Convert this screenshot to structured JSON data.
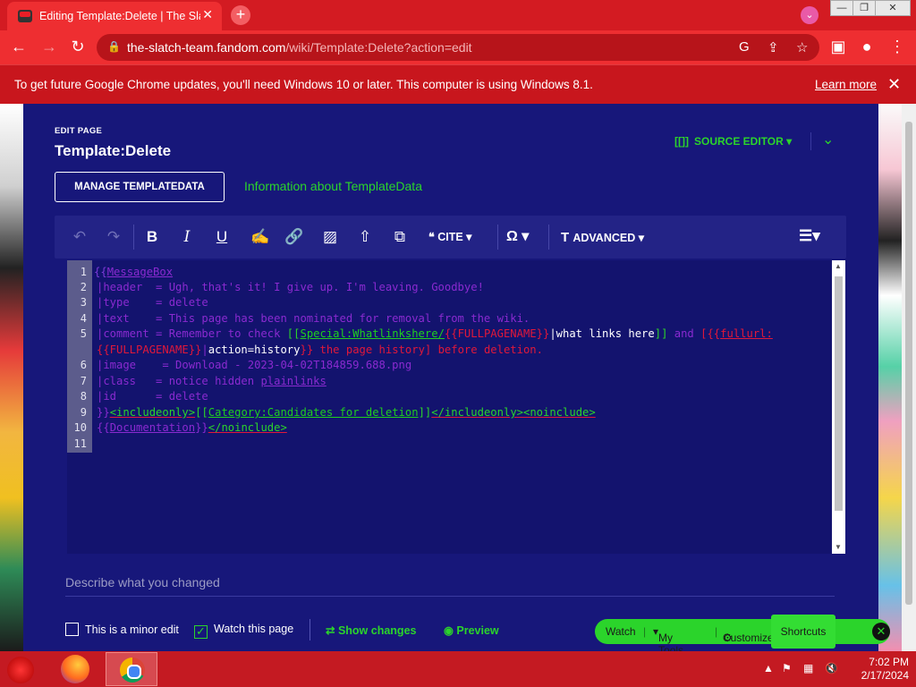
{
  "browser": {
    "tab_title": "Editing Template:Delete | The Sla",
    "tab_close": "✕",
    "new_tab": "+",
    "url_host": "the-slatch-team.fandom.com",
    "url_path": "/wiki/Template:Delete?action=edit",
    "window_min": "—",
    "window_max": "❐",
    "window_close": "✕"
  },
  "infobar": {
    "message": "To get future Google Chrome updates, you'll need Windows 10 or later. This computer is using Windows 8.1.",
    "learn_more": "Learn more",
    "close": "✕"
  },
  "editor": {
    "edit_label": "EDIT PAGE",
    "page_title": "Template:Delete",
    "source_editor": "SOURCE EDITOR",
    "source_icon": "[[]]",
    "manage_templatedata": "MANAGE TEMPLATEDATA",
    "templatedata_info": "Information about TemplateData",
    "toolbar": {
      "cite": "CITE",
      "advanced": "ADVANCED"
    },
    "line_numbers": [
      "1",
      "2",
      "3",
      "4",
      "5",
      "",
      "6",
      "7",
      "8",
      "9",
      "10",
      "11"
    ],
    "summary_placeholder": "Describe what you changed",
    "minor_edit": "This is a minor edit",
    "watch_page": "Watch this page",
    "show_changes": "Show changes",
    "preview": "Preview"
  },
  "code": {
    "l1_open": "{{",
    "l1_name": "MessageBox",
    "l2": "|header  = Ugh, that's it! I give up. I'm leaving. Goodbye!",
    "l3": "|type    = delete",
    "l4": "|text    = This page has been nominated for removal from the wiki.",
    "l5a": "|comment = Remember to check ",
    "l5b": "[[",
    "l5c": "Special:Whatlinkshere/",
    "l5d": "{{FULLPAGENAME}}",
    "l5e": "|what links here",
    "l5f": "]]",
    "l5g": " and ",
    "l5h": "[",
    "l5i": "{{",
    "l5j": "fullurl:",
    "l5k": "{{FULLPAGENAME}}",
    "l5l": "|",
    "l5m": "action=history",
    "l5n": "}}",
    "l5o": " the page history] before deletion.",
    "l6": "|image    = Download - 2023-04-02T184859.688.png",
    "l7a": "|class   = notice hidden ",
    "l7b": "plainlinks",
    "l8": "|id      = delete",
    "l9a": "}}",
    "l9b": "<includeonly>",
    "l9c": "[[",
    "l9d": "Category:Candidates for deletion",
    "l9e": "]]",
    "l9f": "</includeonly>",
    "l9g": "<noinclude>",
    "l10a": "{{",
    "l10b": "Documentation",
    "l10c": "}}",
    "l10d": "</noinclude>"
  },
  "fandom_bar": {
    "watch": "Watch",
    "my_tools": "My Tools",
    "customize": "Customize",
    "shortcuts": "Shortcuts",
    "close": "✕"
  },
  "taskbar": {
    "time": "7:02 PM",
    "date": "2/17/2024"
  },
  "colors": {
    "chrome_red": "#ee2e31",
    "editor_bg": "#17177a",
    "accent_green": "#2bd42b"
  }
}
